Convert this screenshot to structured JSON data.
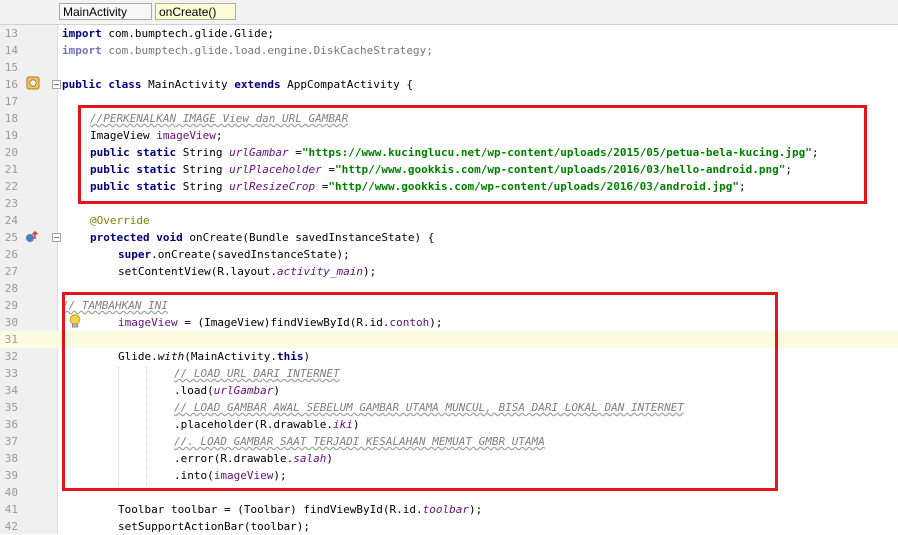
{
  "breadcrumb": {
    "class_name": "MainActivity",
    "method_name": "onCreate()"
  },
  "lines": [
    {
      "num": "13",
      "segs": [
        {
          "t": "kw",
          "v": "import"
        },
        {
          "t": "p",
          "v": " com.bumptech.glide.Glide;"
        }
      ]
    },
    {
      "num": "14",
      "segs": [
        {
          "t": "kw",
          "v": "import"
        },
        {
          "t": "p",
          "v": " com.bumptech.glide.load.engine.DiskCacheStrategy;"
        }
      ],
      "faded": true
    },
    {
      "num": "15",
      "segs": []
    },
    {
      "num": "16",
      "segs": [
        {
          "t": "kw",
          "v": "public class"
        },
        {
          "t": "p",
          "v": " MainActivity "
        },
        {
          "t": "kw",
          "v": "extends"
        },
        {
          "t": "p",
          "v": " AppCompatActivity {"
        }
      ]
    },
    {
      "num": "17",
      "segs": []
    },
    {
      "num": "18",
      "indent": 4,
      "segs": [
        {
          "t": "cm",
          "v": "//PERKENALKAN IMAGE View dan URL GAMBAR"
        }
      ]
    },
    {
      "num": "19",
      "indent": 4,
      "segs": [
        {
          "t": "p",
          "v": "ImageView "
        },
        {
          "t": "ifld",
          "v": "imageView"
        },
        {
          "t": "p",
          "v": ";"
        }
      ]
    },
    {
      "num": "20",
      "indent": 4,
      "segs": [
        {
          "t": "kw",
          "v": "public static"
        },
        {
          "t": "p",
          "v": " String "
        },
        {
          "t": "fld",
          "v": "urlGambar"
        },
        {
          "t": "p",
          "v": " ="
        },
        {
          "t": "str",
          "v": "\"https://www.kucinglucu.net/wp-content/uploads/2015/05/petua-bela-kucing.jpg\""
        },
        {
          "t": "p",
          "v": ";"
        }
      ]
    },
    {
      "num": "21",
      "indent": 4,
      "segs": [
        {
          "t": "kw",
          "v": "public static"
        },
        {
          "t": "p",
          "v": " String "
        },
        {
          "t": "fld",
          "v": "urlPlaceholder"
        },
        {
          "t": "p",
          "v": " ="
        },
        {
          "t": "str",
          "v": "\"http//www.gookkis.com/wp-content/uploads/2016/03/hello-android.png\""
        },
        {
          "t": "p",
          "v": ";"
        }
      ]
    },
    {
      "num": "22",
      "indent": 4,
      "segs": [
        {
          "t": "kw",
          "v": "public static"
        },
        {
          "t": "p",
          "v": " String "
        },
        {
          "t": "fld",
          "v": "urlResizeCrop"
        },
        {
          "t": "p",
          "v": " ="
        },
        {
          "t": "str",
          "v": "\"http//www.gookkis.com/wp-content/uploads/2016/03/android.jpg\""
        },
        {
          "t": "p",
          "v": ";"
        }
      ]
    },
    {
      "num": "23",
      "segs": []
    },
    {
      "num": "24",
      "indent": 4,
      "segs": [
        {
          "t": "ann",
          "v": "@Override"
        }
      ]
    },
    {
      "num": "25",
      "indent": 4,
      "segs": [
        {
          "t": "kw",
          "v": "protected void"
        },
        {
          "t": "p",
          "v": " onCreate(Bundle savedInstanceState) {"
        }
      ]
    },
    {
      "num": "26",
      "indent": 8,
      "segs": [
        {
          "t": "kw",
          "v": "super"
        },
        {
          "t": "p",
          "v": ".onCreate(savedInstanceState);"
        }
      ]
    },
    {
      "num": "27",
      "indent": 8,
      "segs": [
        {
          "t": "p",
          "v": "setContentView(R.layout."
        },
        {
          "t": "fld",
          "v": "activity_main"
        },
        {
          "t": "p",
          "v": ");"
        }
      ]
    },
    {
      "num": "28",
      "segs": []
    },
    {
      "num": "29",
      "segs": [
        {
          "t": "cm",
          "v": "// TAMBAHKAN INI"
        }
      ]
    },
    {
      "num": "30",
      "indent": 8,
      "segs": [
        {
          "t": "ifld",
          "v": "imageView"
        },
        {
          "t": "p",
          "v": " = (ImageView)findViewById(R.id."
        },
        {
          "t": "ifld",
          "v": "contoh"
        },
        {
          "t": "p",
          "v": ");"
        }
      ]
    },
    {
      "num": "31",
      "segs": [],
      "current": true
    },
    {
      "num": "32",
      "indent": 8,
      "segs": [
        {
          "t": "p",
          "v": "Glide."
        },
        {
          "t": "fn",
          "v": "with"
        },
        {
          "t": "p",
          "v": "(MainActivity."
        },
        {
          "t": "kw",
          "v": "this"
        },
        {
          "t": "p",
          "v": ")"
        }
      ]
    },
    {
      "num": "33",
      "indent": 16,
      "segs": [
        {
          "t": "cm",
          "v": "// LOAD URL DARI INTERNET"
        }
      ]
    },
    {
      "num": "34",
      "indent": 16,
      "segs": [
        {
          "t": "p",
          "v": ".load("
        },
        {
          "t": "fld",
          "v": "urlGambar"
        },
        {
          "t": "p",
          "v": ")"
        }
      ]
    },
    {
      "num": "35",
      "indent": 16,
      "segs": [
        {
          "t": "cm",
          "v": "// LOAD GAMBAR AWAL SEBELUM GAMBAR UTAMA MUNCUL, BISA DARI LOKAL DAN INTERNET"
        }
      ]
    },
    {
      "num": "36",
      "indent": 16,
      "segs": [
        {
          "t": "p",
          "v": ".placeholder(R.drawable."
        },
        {
          "t": "fld",
          "v": "iki"
        },
        {
          "t": "p",
          "v": ")"
        }
      ]
    },
    {
      "num": "37",
      "indent": 16,
      "segs": [
        {
          "t": "cm",
          "v": "//. LOAD GAMBAR SAAT TERJADI KESALAHAN MEMUAT GMBR UTAMA"
        }
      ]
    },
    {
      "num": "38",
      "indent": 16,
      "segs": [
        {
          "t": "p",
          "v": ".error(R.drawable."
        },
        {
          "t": "fld",
          "v": "salah"
        },
        {
          "t": "p",
          "v": ")"
        }
      ]
    },
    {
      "num": "39",
      "indent": 16,
      "segs": [
        {
          "t": "p",
          "v": ".into("
        },
        {
          "t": "ifld",
          "v": "imageView"
        },
        {
          "t": "p",
          "v": ");"
        }
      ]
    },
    {
      "num": "40",
      "segs": []
    },
    {
      "num": "41",
      "indent": 8,
      "segs": [
        {
          "t": "p",
          "v": "Toolbar toolbar = (Toolbar) findViewById(R.id."
        },
        {
          "t": "fld",
          "v": "toolbar"
        },
        {
          "t": "p",
          "v": ");"
        }
      ]
    },
    {
      "num": "42",
      "indent": 8,
      "segs": [
        {
          "t": "p",
          "v": "setSupportActionBar(toolbar);"
        }
      ]
    }
  ]
}
